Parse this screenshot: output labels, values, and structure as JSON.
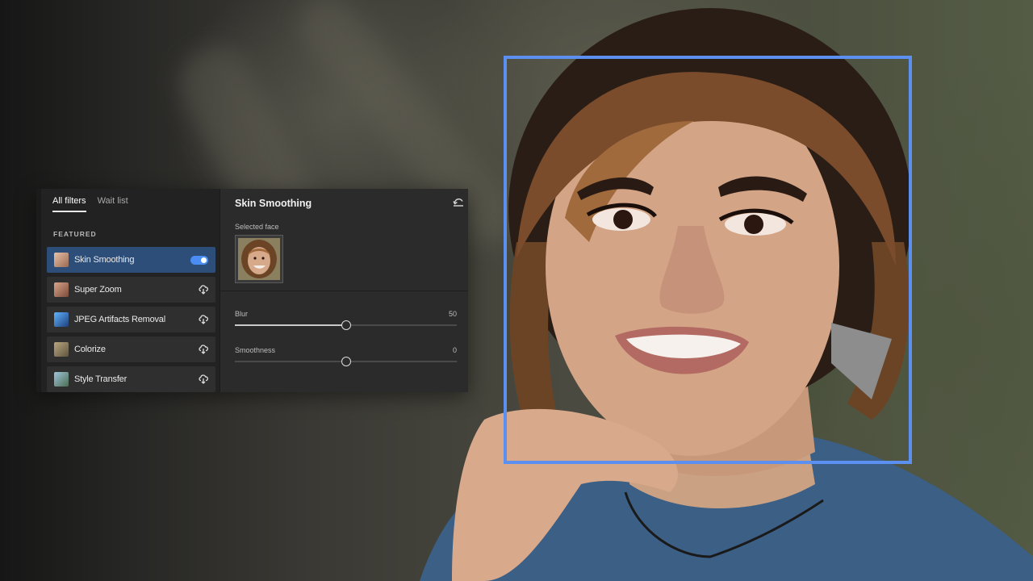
{
  "tabs": [
    {
      "label": "All filters",
      "active": true
    },
    {
      "label": "Wait list",
      "active": false
    }
  ],
  "section_label": "FEATURED",
  "filters": [
    {
      "label": "Skin Smoothing",
      "state": "toggle-on",
      "thumb_color": "#c99a80"
    },
    {
      "label": "Super Zoom",
      "state": "cloud-download",
      "thumb_color": "#b07a66"
    },
    {
      "label": "JPEG Artifacts Removal",
      "state": "cloud-download",
      "thumb_color": "#3d78b8"
    },
    {
      "label": "Colorize",
      "state": "cloud-download",
      "thumb_color": "#8c8466"
    },
    {
      "label": "Style Transfer",
      "state": "cloud-download",
      "thumb_color": "#6f8aa3"
    }
  ],
  "panel": {
    "title": "Skin Smoothing",
    "selected_face_label": "Selected face",
    "reset_icon": "reset-icon"
  },
  "sliders": [
    {
      "name": "Blur",
      "value": "50",
      "level": 0.5
    },
    {
      "name": "Smoothness",
      "value": "0",
      "level": 0.5
    }
  ],
  "colors": {
    "accent": "#4a8df5",
    "face_frame": "#5b8ff0",
    "active_row": "#2d4e79"
  }
}
